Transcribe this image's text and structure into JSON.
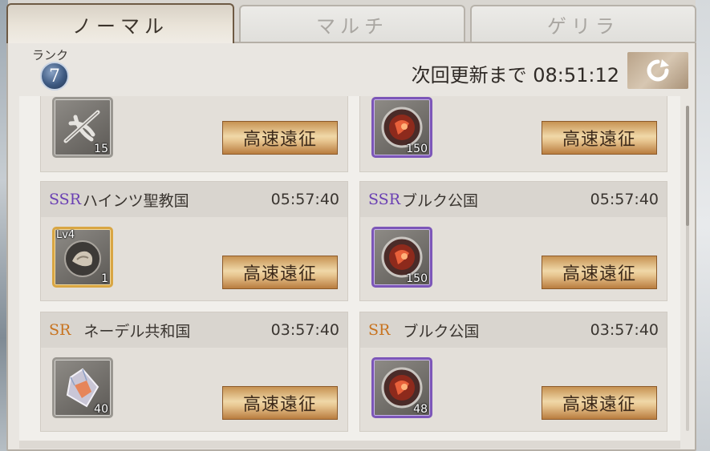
{
  "tabs": [
    {
      "label": "ノーマル",
      "active": true
    },
    {
      "label": "マルチ",
      "active": false
    },
    {
      "label": "ゲリラ",
      "active": false
    }
  ],
  "rank": {
    "label": "ランク",
    "value": "7"
  },
  "refresh": {
    "text": "次回更新まで 08:51:12",
    "icon": "refresh-icon"
  },
  "expedition_label": "高速遠征",
  "cards": [
    {
      "rarity": "",
      "name": "",
      "timer": "",
      "item": {
        "icon": "feather-material-icon",
        "count": "15",
        "level": "",
        "frame": "gray"
      }
    },
    {
      "rarity": "",
      "name": "",
      "timer": "",
      "item": {
        "icon": "fire-orb-icon",
        "count": "150",
        "level": "",
        "frame": "purple"
      }
    },
    {
      "rarity": "SSR",
      "name": "ハインツ聖教国",
      "timer": "05:57:40",
      "item": {
        "icon": "ore-stone-icon",
        "count": "1",
        "level": "Lv4",
        "frame": "gold"
      }
    },
    {
      "rarity": "SSR",
      "name": "ブルク公国",
      "timer": "05:57:40",
      "item": {
        "icon": "fire-orb-icon",
        "count": "150",
        "level": "",
        "frame": "purple"
      }
    },
    {
      "rarity": "SR",
      "name": "ネーデル共和国",
      "timer": "03:57:40",
      "item": {
        "icon": "crystal-gem-icon",
        "count": "40",
        "level": "",
        "frame": "gray"
      }
    },
    {
      "rarity": "SR",
      "name": "ブルク公国",
      "timer": "03:57:40",
      "item": {
        "icon": "fire-orb-icon",
        "count": "48",
        "level": "",
        "frame": "purple"
      }
    }
  ],
  "colors": {
    "ssr": "#6a3fb3",
    "sr": "#c8731f",
    "button_gold": "#e7c590",
    "purple_frame": "#7c56b8"
  }
}
